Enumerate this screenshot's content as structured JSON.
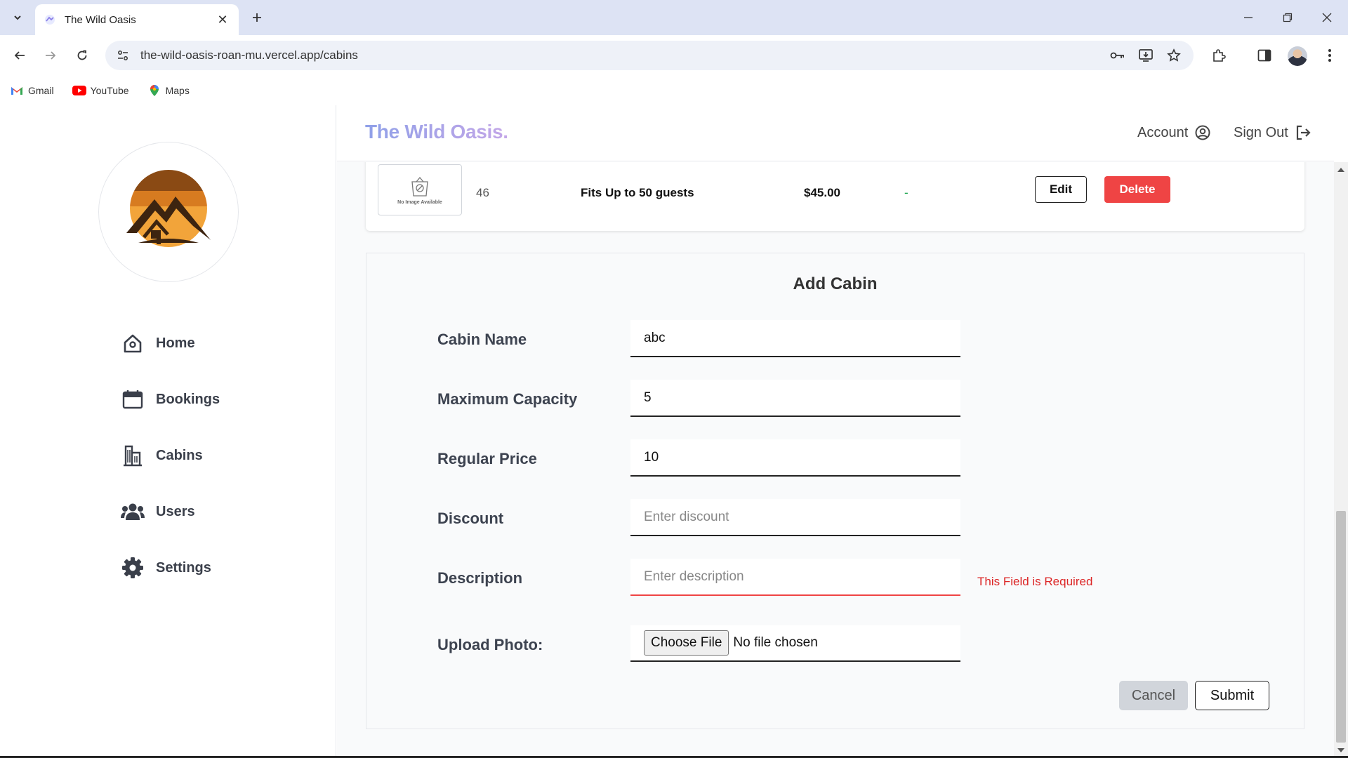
{
  "browser": {
    "tab_title": "The Wild Oasis",
    "url": "the-wild-oasis-roan-mu.vercel.app/cabins",
    "bookmarks": [
      {
        "label": "Gmail",
        "icon": "gmail-icon"
      },
      {
        "label": "YouTube",
        "icon": "youtube-icon"
      },
      {
        "label": "Maps",
        "icon": "maps-icon"
      }
    ]
  },
  "header": {
    "brand": "The Wild Oasis.",
    "account_label": "Account",
    "signout_label": "Sign Out"
  },
  "sidebar": {
    "items": [
      {
        "label": "Home",
        "icon": "home-icon"
      },
      {
        "label": "Bookings",
        "icon": "calendar-icon"
      },
      {
        "label": "Cabins",
        "icon": "building-icon"
      },
      {
        "label": "Users",
        "icon": "users-icon"
      },
      {
        "label": "Settings",
        "icon": "gear-icon"
      }
    ]
  },
  "cabin_row": {
    "image_text": "No Image Available",
    "name": "46",
    "capacity": "Fits Up to 50 guests",
    "price": "$45.00",
    "discount": "-",
    "edit_label": "Edit",
    "delete_label": "Delete"
  },
  "form": {
    "title": "Add Cabin",
    "fields": {
      "name": {
        "label": "Cabin Name",
        "value": "abc"
      },
      "capacity": {
        "label": "Maximum Capacity",
        "value": "5"
      },
      "price": {
        "label": "Regular Price",
        "value": "10"
      },
      "discount": {
        "label": "Discount",
        "value": "",
        "placeholder": "Enter discount"
      },
      "description": {
        "label": "Description",
        "value": "",
        "placeholder": "Enter description",
        "error": "This Field is Required"
      },
      "photo": {
        "label": "Upload Photo:",
        "button": "Choose File",
        "status": "No file chosen"
      }
    },
    "cancel_label": "Cancel",
    "submit_label": "Submit"
  },
  "colors": {
    "accent_delete": "#ef4444",
    "error": "#dc2626",
    "discount": "#16a34a"
  }
}
